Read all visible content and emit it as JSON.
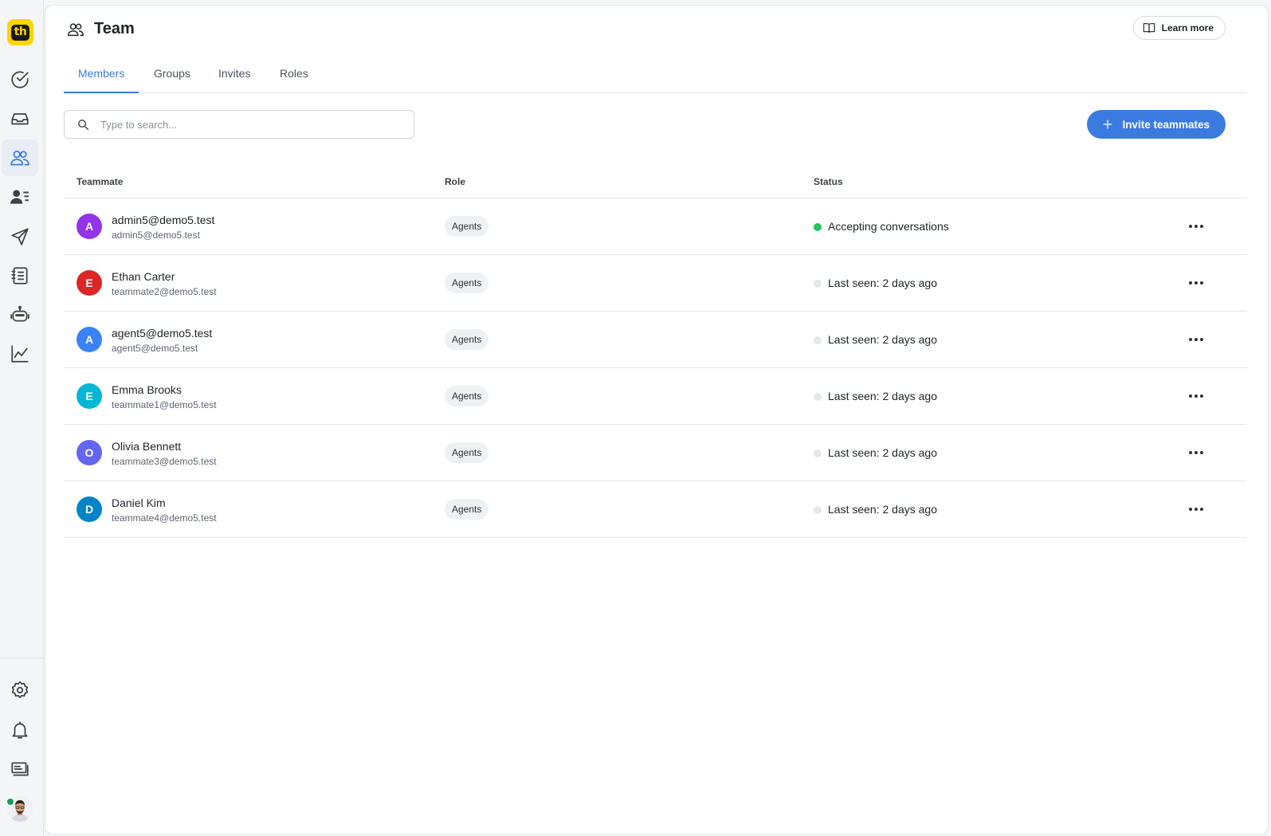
{
  "app": {
    "logo_text": "th"
  },
  "sidebar": {
    "items": [
      {
        "name": "tasks",
        "icon": "check-circle-icon"
      },
      {
        "name": "inbox",
        "icon": "inbox-icon"
      },
      {
        "name": "team",
        "icon": "team-icon",
        "active": true
      },
      {
        "name": "contacts",
        "icon": "contacts-icon"
      },
      {
        "name": "campaigns",
        "icon": "send-icon"
      },
      {
        "name": "knowledge",
        "icon": "notebook-icon"
      },
      {
        "name": "bots",
        "icon": "robot-icon"
      },
      {
        "name": "reports",
        "icon": "chart-icon"
      }
    ],
    "bottom_items": [
      {
        "name": "settings",
        "icon": "gear-icon"
      },
      {
        "name": "notifications",
        "icon": "bell-icon"
      },
      {
        "name": "billing",
        "icon": "billing-icon"
      }
    ]
  },
  "header": {
    "title": "Team",
    "learn_more": "Learn more"
  },
  "tabs": [
    {
      "label": "Members",
      "active": true
    },
    {
      "label": "Groups"
    },
    {
      "label": "Invites"
    },
    {
      "label": "Roles"
    }
  ],
  "search": {
    "placeholder": "Type to search...",
    "value": ""
  },
  "invite_button": "Invite teammates",
  "table": {
    "columns": [
      "Teammate",
      "Role",
      "Status"
    ],
    "rows": [
      {
        "initial": "A",
        "name": "admin5@demo5.test",
        "email": "admin5@demo5.test",
        "role": "Agents",
        "status": "Accepting conversations",
        "online": true,
        "color": "#9333ea"
      },
      {
        "initial": "E",
        "name": "Ethan Carter",
        "email": "teammate2@demo5.test",
        "role": "Agents",
        "status": "Last seen: 2 days ago",
        "online": false,
        "color": "#dc2626"
      },
      {
        "initial": "A",
        "name": "agent5@demo5.test",
        "email": "agent5@demo5.test",
        "role": "Agents",
        "status": "Last seen: 2 days ago",
        "online": false,
        "color": "#3b82f6"
      },
      {
        "initial": "E",
        "name": "Emma Brooks",
        "email": "teammate1@demo5.test",
        "role": "Agents",
        "status": "Last seen: 2 days ago",
        "online": false,
        "color": "#06b6d4"
      },
      {
        "initial": "O",
        "name": "Olivia Bennett",
        "email": "teammate3@demo5.test",
        "role": "Agents",
        "status": "Last seen: 2 days ago",
        "online": false,
        "color": "#6366f1"
      },
      {
        "initial": "D",
        "name": "Daniel Kim",
        "email": "teammate4@demo5.test",
        "role": "Agents",
        "status": "Last seen: 2 days ago",
        "online": false,
        "color": "#0284c7"
      }
    ]
  },
  "colors": {
    "accent": "#3b7be0",
    "online": "#22c55e",
    "offline": "#e5e7eb"
  }
}
